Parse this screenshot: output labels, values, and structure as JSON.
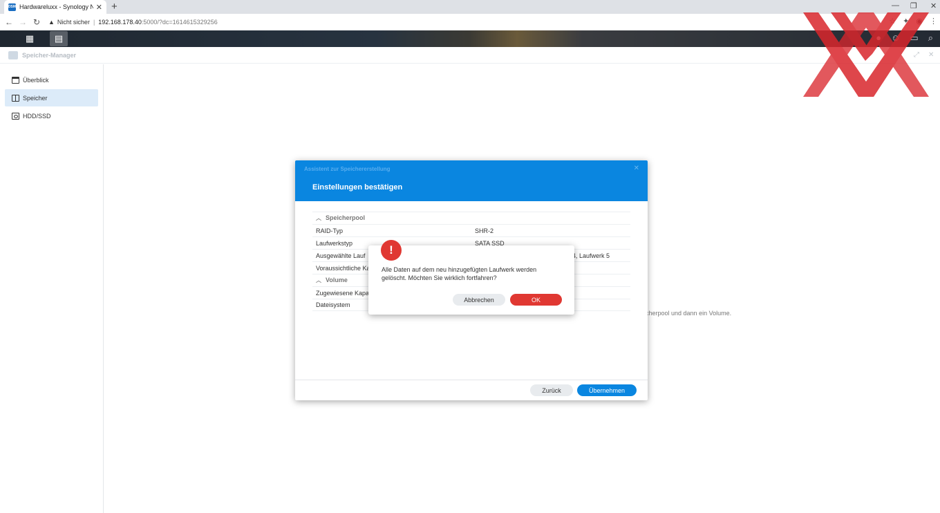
{
  "browser": {
    "tab_title": "Hardwareluxx - Synology NAS",
    "tab_favicon_text": "DSM",
    "security_label": "Nicht sicher",
    "url_host": "192.168.178.40",
    "url_path": ":5000/?dc=1614615329256"
  },
  "app": {
    "title": "Speicher-Manager"
  },
  "sidebar": {
    "items": [
      {
        "label": "Überblick",
        "icon": "overview-icon"
      },
      {
        "label": "Speicher",
        "icon": "storage-pool-icon"
      },
      {
        "label": "HDD/SSD",
        "icon": "hdd-icon"
      }
    ]
  },
  "background": {
    "partial_text": "cherpool und dann ein Volume."
  },
  "wizard": {
    "subtitle": "Assistent zur Speichererstellung",
    "title": "Einstellungen bestätigen",
    "sections": {
      "pool": "Speicherpool",
      "volume": "Volume"
    },
    "rows": {
      "raid_label": "RAID-Typ",
      "raid_value": "SHR-2",
      "drive_type_label": "Laufwerkstyp",
      "drive_type_value": "SATA SSD",
      "selected_label": "Ausgewählte Lauf",
      "selected_value": "4, Laufwerk 5",
      "expected_label": "Voraussichtliche Ka",
      "assigned_label": "Zugewiesene Kapa",
      "fs_label": "Dateisystem"
    },
    "back_label": "Zurück",
    "apply_label": "Übernehmen"
  },
  "confirm": {
    "icon": "!",
    "message": "Alle Daten auf dem neu hinzugefügten Laufwerk werden gelöscht. Möchten Sie wirklich fortfahren?",
    "cancel_label": "Abbrechen",
    "ok_label": "OK"
  },
  "colors": {
    "accent": "#0a86e0",
    "danger": "#e03832",
    "sidebar_active": "#dcebf9",
    "watermark": "#d9262c"
  }
}
